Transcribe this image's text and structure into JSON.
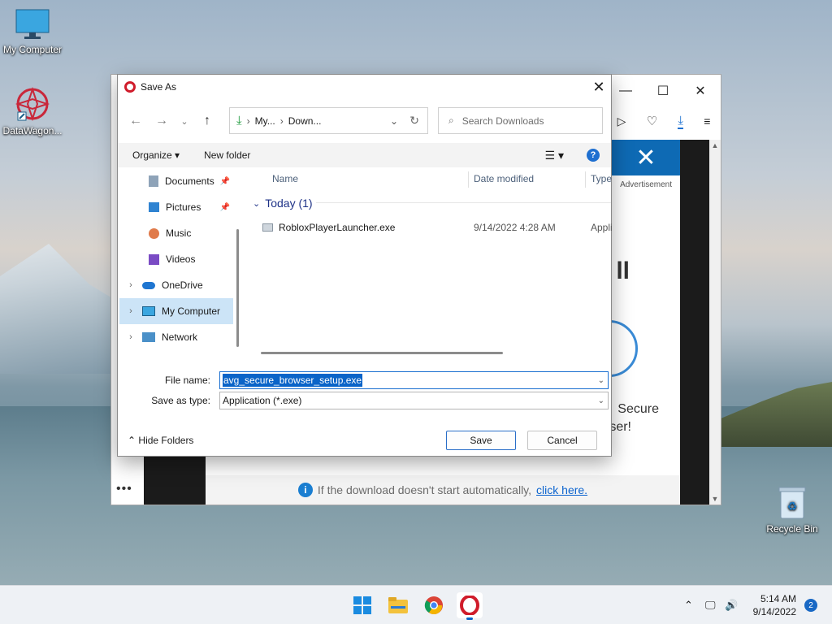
{
  "desktop": {
    "icons": [
      {
        "label": "My Computer"
      },
      {
        "label": "DataWagon..."
      },
      {
        "label": "Recycle Bin"
      }
    ]
  },
  "browser": {
    "ad_label": "Advertisement",
    "ad_text_fragments": [
      "ll",
      "Secure",
      "ser!"
    ],
    "download_notice": "If the download doesn't start automatically,",
    "download_link": "click here."
  },
  "dialog": {
    "title": "Save As",
    "address": {
      "segments": [
        "My...",
        "Down..."
      ]
    },
    "search_placeholder": "Search Downloads",
    "toolbar": {
      "organize": "Organize",
      "new_folder": "New folder",
      "help": "?"
    },
    "nav": [
      {
        "label": "Documents",
        "icon": "documents-icon",
        "pinned": true
      },
      {
        "label": "Pictures",
        "icon": "pictures-icon",
        "pinned": true
      },
      {
        "label": "Music",
        "icon": "music-icon",
        "pinned": false
      },
      {
        "label": "Videos",
        "icon": "videos-icon",
        "pinned": false
      },
      {
        "label": "OneDrive",
        "icon": "onedrive-icon",
        "expandable": true
      },
      {
        "label": "My Computer",
        "icon": "computer-icon",
        "expandable": true,
        "selected": true
      },
      {
        "label": "Network",
        "icon": "network-icon",
        "expandable": true
      }
    ],
    "columns": [
      "Name",
      "Date modified",
      "Type"
    ],
    "group": "Today (1)",
    "files": [
      {
        "name": "RobloxPlayerLauncher.exe",
        "date": "9/14/2022 4:28 AM",
        "type": "Appli"
      }
    ],
    "file_name_label": "File name:",
    "file_name_value": "avg_secure_browser_setup.exe",
    "save_type_label": "Save as type:",
    "save_type_value": "Application (*.exe)",
    "hide_folders": "Hide Folders",
    "save": "Save",
    "cancel": "Cancel"
  },
  "taskbar": {
    "time": "5:14 AM",
    "date": "9/14/2022",
    "notifications": "2",
    "accent": "#0a64c8"
  }
}
